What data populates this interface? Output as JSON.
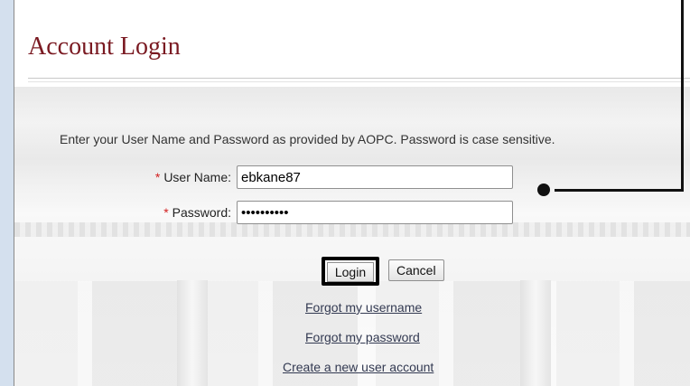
{
  "page": {
    "title": "Account Login",
    "instructions": "Enter your User Name and Password as provided by AOPC. Password is case sensitive."
  },
  "form": {
    "required_marker": "*",
    "username_label": "User Name:",
    "username_value": "ebkane87",
    "password_label": "Password:",
    "password_value": "ebkane8701"
  },
  "buttons": {
    "login": "Login",
    "cancel": "Cancel"
  },
  "links": {
    "forgot_username": "Forgot my username",
    "forgot_password": "Forgot my password",
    "create_account": "Create a new user account"
  },
  "colors": {
    "title": "#7a1a22",
    "required": "#d21f1f",
    "callout": "#111111"
  }
}
